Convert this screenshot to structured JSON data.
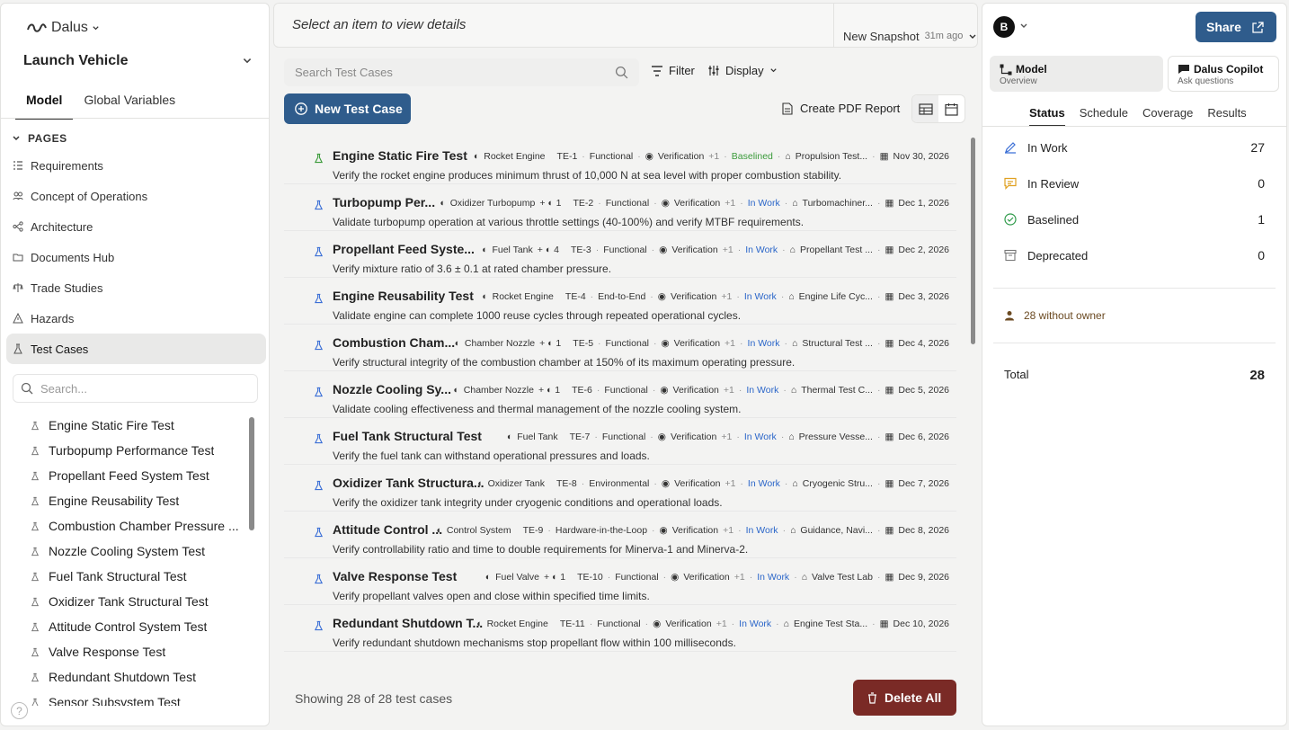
{
  "sidebar": {
    "logo_text": "Dalus",
    "project": "Launch Vehicle",
    "tabs": [
      "Model",
      "Global Variables"
    ],
    "pages_heading": "PAGES",
    "pages": [
      {
        "label": "Requirements",
        "icon": "list-icon"
      },
      {
        "label": "Concept of Operations",
        "icon": "people-icon"
      },
      {
        "label": "Architecture",
        "icon": "architecture-icon"
      },
      {
        "label": "Documents Hub",
        "icon": "folder-icon"
      },
      {
        "label": "Trade Studies",
        "icon": "scale-icon"
      },
      {
        "label": "Hazards",
        "icon": "warning-icon"
      },
      {
        "label": "Test Cases",
        "icon": "flask-icon",
        "active": true
      }
    ],
    "search_placeholder": "Search...",
    "tree": [
      "Engine Static Fire Test",
      "Turbopump Performance Test",
      "Propellant Feed System Test",
      "Engine Reusability Test",
      "Combustion Chamber Pressure ...",
      "Nozzle Cooling System Test",
      "Fuel Tank Structural Test",
      "Oxidizer Tank Structural Test",
      "Attitude Control System Test",
      "Valve Response Test",
      "Redundant Shutdown Test",
      "Sensor Subsystem Test"
    ],
    "help": "?"
  },
  "topbar": {
    "placeholder": "Select an item to view details",
    "snapshot_label": "New Snapshot",
    "snapshot_age": "31m ago"
  },
  "toolbar": {
    "search_placeholder": "Search Test Cases",
    "filter": "Filter",
    "display": "Display",
    "new_button": "New Test Case",
    "pdf_button": "Create PDF Report"
  },
  "test_cases": [
    {
      "title": "Engine Static Fire Test",
      "component": "Rocket Engine",
      "extra": "",
      "id": "TE-1",
      "type": "Functional",
      "method": "Verification",
      "plus": "+1",
      "status": "Baselined",
      "facility": "Propulsion Test...",
      "date": "Nov 30, 2026",
      "desc": "Verify the rocket engine produces minimum thrust of 10,000 N at sea level with proper combustion stability."
    },
    {
      "title": "Turbopump Per...",
      "component": "Oxidizer Turbopump",
      "extra": "+ ◐ 1",
      "id": "TE-2",
      "type": "Functional",
      "method": "Verification",
      "plus": "+1",
      "status": "In Work",
      "facility": "Turbomachiner...",
      "date": "Dec 1, 2026",
      "desc": "Validate turbopump operation at various throttle settings (40-100%) and verify MTBF requirements."
    },
    {
      "title": "Propellant Feed Syste...",
      "component": "Fuel Tank",
      "extra": "+ ◐ 4",
      "id": "TE-3",
      "type": "Functional",
      "method": "Verification",
      "plus": "+1",
      "status": "In Work",
      "facility": "Propellant Test ...",
      "date": "Dec 2, 2026",
      "desc": "Verify mixture ratio of 3.6 ± 0.1 at rated chamber pressure."
    },
    {
      "title": "Engine Reusability Test",
      "component": "Rocket Engine",
      "extra": "",
      "id": "TE-4",
      "type": "End-to-End",
      "method": "Verification",
      "plus": "+1",
      "status": "In Work",
      "facility": "Engine Life Cyc...",
      "date": "Dec 3, 2026",
      "desc": "Validate engine can complete 1000 reuse cycles through repeated operational cycles."
    },
    {
      "title": "Combustion Cham...",
      "component": "Chamber Nozzle",
      "extra": "+ ◐ 1",
      "id": "TE-5",
      "type": "Functional",
      "method": "Verification",
      "plus": "+1",
      "status": "In Work",
      "facility": "Structural Test ...",
      "date": "Dec 4, 2026",
      "desc": "Verify structural integrity of the combustion chamber at 150% of its maximum operating pressure."
    },
    {
      "title": "Nozzle Cooling Sy...",
      "component": "Chamber Nozzle",
      "extra": "+ ◐ 1",
      "id": "TE-6",
      "type": "Functional",
      "method": "Verification",
      "plus": "+1",
      "status": "In Work",
      "facility": "Thermal Test C...",
      "date": "Dec 5, 2026",
      "desc": "Validate cooling effectiveness and thermal management of the nozzle cooling system."
    },
    {
      "title": "Fuel Tank Structural Test",
      "component": "Fuel Tank",
      "extra": "",
      "id": "TE-7",
      "type": "Functional",
      "method": "Verification",
      "plus": "+1",
      "status": "In Work",
      "facility": "Pressure Vesse...",
      "date": "Dec 6, 2026",
      "desc": "Verify the fuel tank can withstand operational pressures and loads."
    },
    {
      "title": "Oxidizer Tank Structura...",
      "component": "Oxidizer Tank",
      "extra": "",
      "id": "TE-8",
      "type": "Environmental",
      "method": "Verification",
      "plus": "+1",
      "status": "In Work",
      "facility": "Cryogenic Stru...",
      "date": "Dec 7, 2026",
      "desc": "Verify the oxidizer tank integrity under cryogenic conditions and operational loads."
    },
    {
      "title": "Attitude Control ...",
      "component": "Control System",
      "extra": "",
      "id": "TE-9",
      "type": "Hardware-in-the-Loop",
      "method": "Verification",
      "plus": "+1",
      "status": "In Work",
      "facility": "Guidance, Navi...",
      "date": "Dec 8, 2026",
      "desc": "Verify controllability ratio and time to double requirements for Minerva-1 and Minerva-2."
    },
    {
      "title": "Valve Response Test",
      "component": "Fuel Valve",
      "extra": "+ ◐ 1",
      "id": "TE-10",
      "type": "Functional",
      "method": "Verification",
      "plus": "+1",
      "status": "In Work",
      "facility": "Valve Test Lab",
      "date": "Dec 9, 2026",
      "desc": "Verify propellant valves open and close within specified time limits."
    },
    {
      "title": "Redundant Shutdown T...",
      "component": "Rocket Engine",
      "extra": "",
      "id": "TE-11",
      "type": "Functional",
      "method": "Verification",
      "plus": "+1",
      "status": "In Work",
      "facility": "Engine Test Sta...",
      "date": "Dec 10, 2026",
      "desc": "Verify redundant shutdown mechanisms stop propellant flow within 100 milliseconds."
    }
  ],
  "footer": {
    "showing": "Showing 28 of 28 test cases",
    "delete_button": "Delete All"
  },
  "right": {
    "avatar": "B",
    "share": "Share",
    "modes": [
      {
        "title": "Model",
        "sub": "Overview",
        "active": true
      },
      {
        "title": "Dalus Copilot",
        "sub": "Ask questions",
        "active": false
      }
    ],
    "tabs": [
      "Status",
      "Schedule",
      "Coverage",
      "Results"
    ],
    "stats": [
      {
        "label": "In Work",
        "value": "27",
        "icon": "pencil-icon",
        "color": "#3b6fd6"
      },
      {
        "label": "In Review",
        "value": "0",
        "icon": "comment-icon",
        "color": "#e0a020"
      },
      {
        "label": "Baselined",
        "value": "1",
        "icon": "check-circle-icon",
        "color": "#2e9a4a"
      },
      {
        "label": "Deprecated",
        "value": "0",
        "icon": "archive-icon",
        "color": "#777777"
      }
    ],
    "owner": "28 without owner",
    "total_label": "Total",
    "total_value": "28"
  },
  "colors": {
    "primary": "#2f5c8c",
    "danger": "#7a2a26",
    "in_work": "#2b66c9",
    "baselined": "#3a9a3a"
  }
}
